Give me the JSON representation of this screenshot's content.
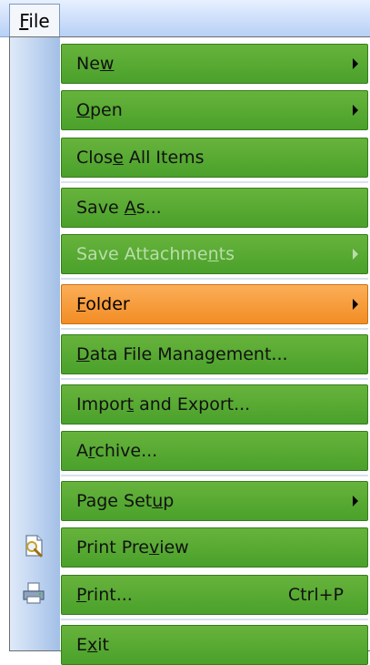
{
  "menubar": {
    "file_label": "File"
  },
  "menu": {
    "items": [
      {
        "id": "new",
        "label": "New",
        "pre": "Ne",
        "mn": "w",
        "post": "",
        "submenu": true,
        "disabled": false
      },
      {
        "id": "open",
        "label": "Open",
        "pre": "",
        "mn": "O",
        "post": "pen",
        "submenu": true,
        "disabled": false
      },
      {
        "id": "close-all-items",
        "label": "Close All Items",
        "pre": "Clos",
        "mn": "e",
        "post": " All Items",
        "submenu": false,
        "disabled": false
      },
      {
        "id": "save-as",
        "label": "Save As...",
        "pre": "Save ",
        "mn": "A",
        "post": "s...",
        "submenu": false,
        "disabled": false
      },
      {
        "id": "save-attachments",
        "label": "Save Attachments",
        "pre": "Save Attachme",
        "mn": "n",
        "post": "ts",
        "submenu": true,
        "disabled": true
      },
      {
        "id": "folder",
        "label": "Folder",
        "pre": "",
        "mn": "F",
        "post": "older",
        "submenu": true,
        "disabled": false,
        "highlighted": true
      },
      {
        "id": "data-file-management",
        "label": "Data File Management...",
        "pre": "",
        "mn": "D",
        "post": "ata File Management...",
        "submenu": false,
        "disabled": false
      },
      {
        "id": "import-and-export",
        "label": "Import and Export...",
        "pre": "Impor",
        "mn": "t",
        "post": " and Export...",
        "submenu": false,
        "disabled": false
      },
      {
        "id": "archive",
        "label": "Archive...",
        "pre": "A",
        "mn": "r",
        "post": "chive...",
        "submenu": false,
        "disabled": false
      },
      {
        "id": "page-setup",
        "label": "Page Setup",
        "pre": "Page Set",
        "mn": "u",
        "post": "p",
        "submenu": true,
        "disabled": false
      },
      {
        "id": "print-preview",
        "label": "Print Preview",
        "pre": "Print Pre",
        "mn": "v",
        "post": "iew",
        "submenu": false,
        "disabled": false,
        "icon": "print-preview-icon"
      },
      {
        "id": "print",
        "label": "Print...",
        "pre": "",
        "mn": "P",
        "post": "rint...",
        "submenu": false,
        "disabled": false,
        "shortcut": "Ctrl+P",
        "icon": "printer-icon"
      },
      {
        "id": "exit",
        "label": "Exit",
        "pre": "E",
        "mn": "x",
        "post": "it",
        "submenu": false,
        "disabled": false
      }
    ]
  },
  "colors": {
    "item_green": "#55a82f",
    "highlight_orange": "#f5962f",
    "disabled_text": "#b9dea9",
    "gutter_blue": "#bed3f0"
  }
}
